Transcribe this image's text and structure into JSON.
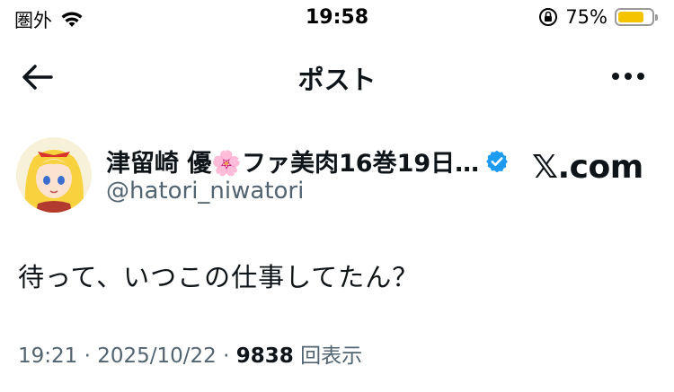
{
  "status_bar": {
    "carrier": "圏外",
    "time": "19:58",
    "battery_percent": "75%",
    "battery_level": 0.75,
    "battery_color": "#f5c400"
  },
  "nav": {
    "title": "ポスト",
    "back_icon": "arrow-left-icon",
    "more_icon": "more-horizontal-icon"
  },
  "author": {
    "display_name": "津留崎 優🌸ファ美肉16巻19日…",
    "handle": "@hatori_niwatori",
    "verified": true,
    "verified_color": "#1d9bf0"
  },
  "watermark": "𝕏.com",
  "tweet": {
    "text": "待って、いつこの仕事してたん？"
  },
  "meta": {
    "time": "19:21",
    "sep1": " · ",
    "date": "2025/10/22",
    "sep2": " · ",
    "views": "9838",
    "views_label": "回表示"
  }
}
